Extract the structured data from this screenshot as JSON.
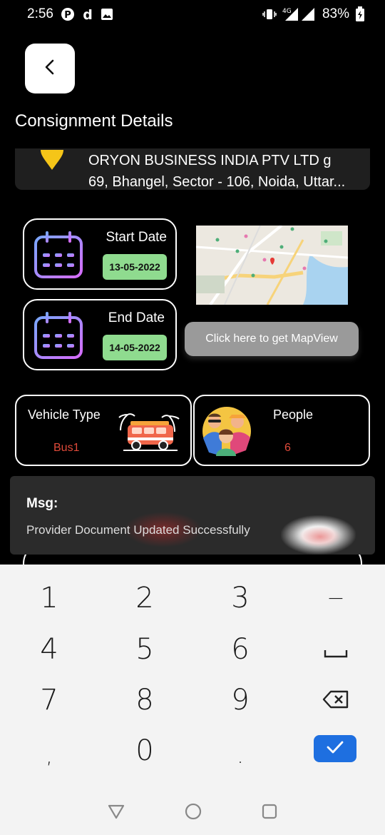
{
  "status_bar": {
    "time": "2:56",
    "network": "4G",
    "battery": "83%",
    "icons": [
      "p-icon",
      "d-icon",
      "image-icon",
      "vibrate-icon",
      "signal-icon",
      "battery-icon"
    ]
  },
  "header": {
    "back_icon": "chevron-left-icon",
    "title": "Consignment Details"
  },
  "address": {
    "line1": "ORYON BUSINESS INDIA PTV LTD g",
    "line2": "69, Bhangel, Sector - 106, Noida, Uttar...",
    "pin_color": "#f5c518"
  },
  "dates": {
    "start_label": "Start Date",
    "start_value": "13-05-2022",
    "end_label": "End Date",
    "end_value": "14-05-2022"
  },
  "map": {
    "button_label": "Click here to get MapView"
  },
  "vehicle": {
    "label": "Vehicle Type",
    "value": "Bus1"
  },
  "people": {
    "label": "People",
    "value": "6"
  },
  "toast": {
    "title": "Msg:",
    "message": "Provider Document Updated Successfully"
  },
  "keyboard": {
    "keys": [
      "1",
      "2",
      "3",
      "−",
      "4",
      "5",
      "6",
      "␣",
      "7",
      "8",
      "9",
      "⌫",
      ",",
      "0",
      "."
    ],
    "done_color": "#1e6fe0"
  },
  "colors": {
    "accent_green": "#8fdb8f",
    "value_red": "#e04a3a"
  }
}
